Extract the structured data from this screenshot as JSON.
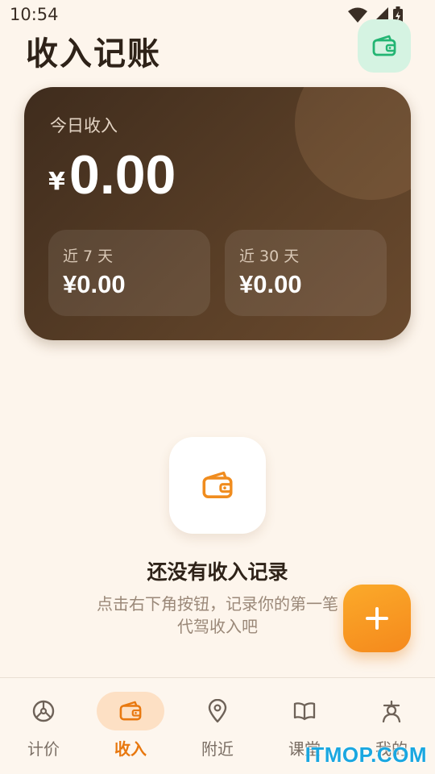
{
  "status_bar": {
    "time": "10:54"
  },
  "header": {
    "title": "收入记账",
    "wallet_icon": "wallet-icon",
    "accent": "#23b573"
  },
  "summary": {
    "today_label": "今日收入",
    "currency": "¥",
    "today_amount": "0.00",
    "week_label": "近 7 天",
    "week_value": "¥0.00",
    "month_label": "近 30 天",
    "month_value": "¥0.00"
  },
  "empty_state": {
    "icon": "wallet-icon",
    "title": "还没有收入记录",
    "desc_line1": "点击右下角按钮，记录你的第一笔",
    "desc_line2": "代驾收入吧"
  },
  "fab": {
    "icon": "plus-icon",
    "color": "#f7931e"
  },
  "nav": {
    "items": [
      {
        "label": "计价",
        "icon": "steering-wheel-icon"
      },
      {
        "label": "收入",
        "icon": "wallet-icon",
        "active": true
      },
      {
        "label": "附近",
        "icon": "location-pin-icon"
      },
      {
        "label": "课堂",
        "icon": "book-icon"
      },
      {
        "label": "我的",
        "icon": "profile-icon"
      }
    ]
  },
  "watermark": "ITMOP.COM"
}
